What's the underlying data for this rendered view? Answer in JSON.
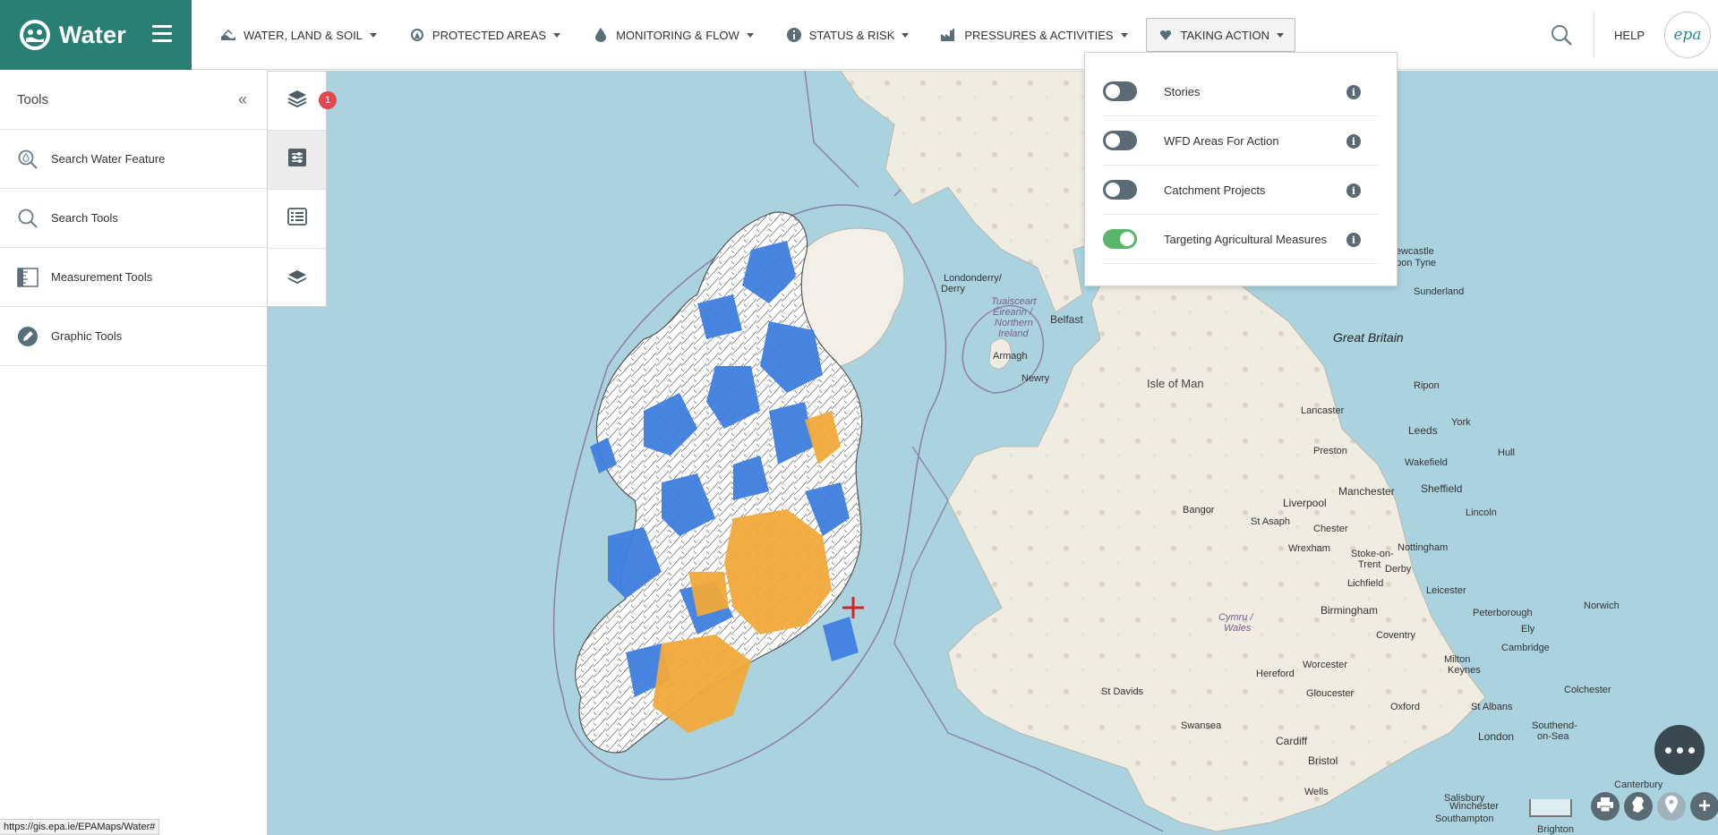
{
  "app": {
    "title": "Water"
  },
  "nav": {
    "items": [
      {
        "label": "WATER, LAND & SOIL",
        "icon": "water-land-icon"
      },
      {
        "label": "PROTECTED AREAS",
        "icon": "protected-areas-icon"
      },
      {
        "label": "MONITORING & FLOW",
        "icon": "water-drop-icon"
      },
      {
        "label": "STATUS & RISK",
        "icon": "info-circle-icon"
      },
      {
        "label": "PRESSURES & ACTIVITIES",
        "icon": "factory-icon"
      },
      {
        "label": "TAKING ACTION",
        "icon": "heart-icon",
        "active": true
      }
    ],
    "help_label": "HELP",
    "logo_text": "epa"
  },
  "sidebar": {
    "title": "Tools",
    "items": [
      {
        "label": "Search Water Feature",
        "icon": "search-water-feature-icon"
      },
      {
        "label": "Search Tools",
        "icon": "search-icon"
      },
      {
        "label": "Measurement Tools",
        "icon": "measurement-icon"
      },
      {
        "label": "Graphic Tools",
        "icon": "pencil-icon"
      }
    ]
  },
  "rail": {
    "badge_count": "1",
    "buttons": [
      "layers-icon",
      "sliders-icon",
      "legend-list-icon",
      "basemap-icon"
    ]
  },
  "dropdown": {
    "items": [
      {
        "label": "Stories",
        "on": false
      },
      {
        "label": "WFD Areas For Action",
        "on": false
      },
      {
        "label": "Catchment Projects",
        "on": false
      },
      {
        "label": "Targeting Agricultural Measures",
        "on": true
      }
    ],
    "info_glyph": "i"
  },
  "map": {
    "labels": {
      "londonderry": "Londonderry/",
      "derry": "Derry",
      "tuaisceart": "Tuaisceart",
      "eireann": "Éireann /",
      "northern": "Northern",
      "ireland": "Ireland",
      "belfast": "Belfast",
      "armagh": "Armagh",
      "newry": "Newry",
      "isle_of_man": "Isle of Man",
      "great_britain": "Great Britain",
      "newcastle": "Newcastle",
      "upon_tyne": "upon Tyne",
      "sunderland": "Sunderland",
      "ripon": "Ripon",
      "lancaster": "Lancaster",
      "york": "York",
      "leeds": "Leeds",
      "preston": "Preston",
      "wakefield": "Wakefield",
      "hull": "Hull",
      "sheffield": "Sheffield",
      "liverpool": "Liverpool",
      "manchester": "Manchester",
      "bangor": "Bangor",
      "st_asaph": "St Asaph",
      "chester": "Chester",
      "lincoln": "Lincoln",
      "wrexham": "Wrexham",
      "stoke": "Stoke-on-",
      "trent": "Trent",
      "nottingham": "Nottingham",
      "derby": "Derby",
      "lichfield": "Lichfield",
      "leicester": "Leicester",
      "norwich": "Norwich",
      "cymru": "Cymru /",
      "wales": "Wales",
      "birmingham": "Birmingham",
      "peterborough": "Peterborough",
      "coventry": "Coventry",
      "ely": "Ely",
      "cambridge": "Cambridge",
      "worcester": "Worcester",
      "milton": "Milton",
      "keynes": "Keynes",
      "st_davids": "St Davids",
      "hereford": "Hereford",
      "gloucester": "Gloucester",
      "colchester": "Colchester",
      "oxford": "Oxford",
      "st_albans": "St Albans",
      "swansea": "Swansea",
      "southend": "Southend-",
      "on_sea": "on-Sea",
      "cardiff": "Cardiff",
      "london": "London",
      "bristol": "Bristol",
      "wells": "Wells",
      "salisbury": "Salisbury",
      "winchester": "Winchester",
      "canterbury": "Canterbury",
      "southampton": "Southampton",
      "brighton": "Brighton"
    }
  },
  "status_url": "https://gis.epa.ie/EPAMaps/Water#",
  "colors": {
    "brand": "#2a7f75",
    "sea": "#aad3df",
    "toggle_on": "#59b66b",
    "toggle_off": "#5b6b75",
    "badge": "#e0474f",
    "blue_area": "#3f7fe0",
    "orange_area": "#f2a93b"
  }
}
